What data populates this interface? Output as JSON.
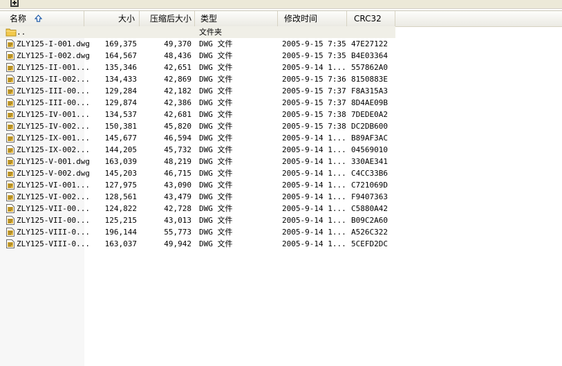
{
  "toolbar": {
    "icon": "extract-icon"
  },
  "columns": {
    "name": "名称",
    "size": "大小",
    "packed": "压缩后大小",
    "type": "类型",
    "modified": "修改时间",
    "crc": "CRC32"
  },
  "updir": {
    "name": "..",
    "type": "文件夹"
  },
  "files": [
    {
      "name": "ZLY125-I-001.dwg",
      "size": "169,375",
      "packed": "49,370",
      "type": "DWG 文件",
      "modified": "2005-9-15 7:35",
      "crc": "47E27122"
    },
    {
      "name": "ZLY125-I-002.dwg",
      "size": "164,567",
      "packed": "48,436",
      "type": "DWG 文件",
      "modified": "2005-9-15 7:35",
      "crc": "B4E03364"
    },
    {
      "name": "ZLY125-II-001...",
      "size": "135,346",
      "packed": "42,651",
      "type": "DWG 文件",
      "modified": "2005-9-14 1...",
      "crc": "557862A0"
    },
    {
      "name": "ZLY125-II-002...",
      "size": "134,433",
      "packed": "42,869",
      "type": "DWG 文件",
      "modified": "2005-9-15 7:36",
      "crc": "8150883E"
    },
    {
      "name": "ZLY125-III-00...",
      "size": "129,284",
      "packed": "42,182",
      "type": "DWG 文件",
      "modified": "2005-9-15 7:37",
      "crc": "F8A315A3"
    },
    {
      "name": "ZLY125-III-00...",
      "size": "129,874",
      "packed": "42,386",
      "type": "DWG 文件",
      "modified": "2005-9-15 7:37",
      "crc": "8D4AE09B"
    },
    {
      "name": "ZLY125-IV-001...",
      "size": "134,537",
      "packed": "42,681",
      "type": "DWG 文件",
      "modified": "2005-9-15 7:38",
      "crc": "7DEDE0A2"
    },
    {
      "name": "ZLY125-IV-002...",
      "size": "150,381",
      "packed": "45,820",
      "type": "DWG 文件",
      "modified": "2005-9-15 7:38",
      "crc": "DC2DB600"
    },
    {
      "name": "ZLY125-IX-001...",
      "size": "145,677",
      "packed": "46,594",
      "type": "DWG 文件",
      "modified": "2005-9-14 1...",
      "crc": "B89AF3AC"
    },
    {
      "name": "ZLY125-IX-002...",
      "size": "144,205",
      "packed": "45,732",
      "type": "DWG 文件",
      "modified": "2005-9-14 1...",
      "crc": "04569010"
    },
    {
      "name": "ZLY125-V-001.dwg",
      "size": "163,039",
      "packed": "48,219",
      "type": "DWG 文件",
      "modified": "2005-9-14 1...",
      "crc": "330AE341"
    },
    {
      "name": "ZLY125-V-002.dwg",
      "size": "145,203",
      "packed": "46,715",
      "type": "DWG 文件",
      "modified": "2005-9-14 1...",
      "crc": "C4CC33B6"
    },
    {
      "name": "ZLY125-VI-001...",
      "size": "127,975",
      "packed": "43,090",
      "type": "DWG 文件",
      "modified": "2005-9-14 1...",
      "crc": "C721069D"
    },
    {
      "name": "ZLY125-VI-002...",
      "size": "128,561",
      "packed": "43,479",
      "type": "DWG 文件",
      "modified": "2005-9-14 1...",
      "crc": "F9407363"
    },
    {
      "name": "ZLY125-VII-00...",
      "size": "124,822",
      "packed": "42,728",
      "type": "DWG 文件",
      "modified": "2005-9-14 1...",
      "crc": "C5880A42"
    },
    {
      "name": "ZLY125-VII-00...",
      "size": "125,215",
      "packed": "43,013",
      "type": "DWG 文件",
      "modified": "2005-9-14 1...",
      "crc": "B09C2A60"
    },
    {
      "name": "ZLY125-VIII-0...",
      "size": "196,144",
      "packed": "55,773",
      "type": "DWG 文件",
      "modified": "2005-9-14 1...",
      "crc": "A526C322"
    },
    {
      "name": "ZLY125-VIII-0...",
      "size": "163,037",
      "packed": "49,942",
      "type": "DWG 文件",
      "modified": "2005-9-14 1...",
      "crc": "5CEFD2DC"
    }
  ],
  "colors": {
    "header_bg": "#ebeae3",
    "updir_bg": "#f0efe7",
    "name_col_bg": "#f7f7f7",
    "folder": "#f2c94c"
  }
}
